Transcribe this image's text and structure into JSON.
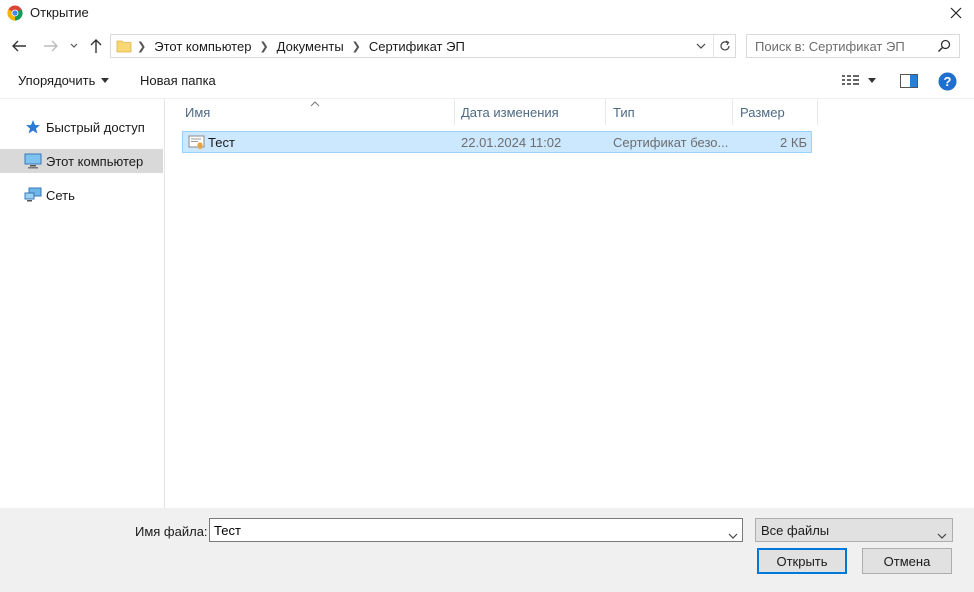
{
  "window": {
    "title": "Открытие"
  },
  "address": {
    "crumbs": [
      "Этот компьютер",
      "Документы",
      "Сертификат ЭП"
    ]
  },
  "search": {
    "placeholder": "Поиск в: Сертификат ЭП"
  },
  "toolbar": {
    "organize_label": "Упорядочить",
    "new_folder_label": "Новая папка"
  },
  "sidebar": {
    "items": [
      {
        "label": "Быстрый доступ",
        "icon": "star-icon"
      },
      {
        "label": "Этот компьютер",
        "icon": "computer-icon",
        "selected": true
      },
      {
        "label": "Сеть",
        "icon": "network-icon"
      }
    ]
  },
  "columns": [
    "Имя",
    "Дата изменения",
    "Тип",
    "Размер"
  ],
  "files": [
    {
      "name": "Тест",
      "date": "22.01.2024 11:02",
      "type": "Сертификат безо...",
      "size": "2 КБ",
      "selected": true
    }
  ],
  "bottom": {
    "filename_label": "Имя файла:",
    "filename_value": "Тест",
    "filter_value": "Все файлы",
    "open_label": "Открыть",
    "cancel_label": "Отмена"
  },
  "colors": {
    "selection_bg": "#cce8ff",
    "accent": "#0078d7",
    "help": "#1f6fd1"
  }
}
